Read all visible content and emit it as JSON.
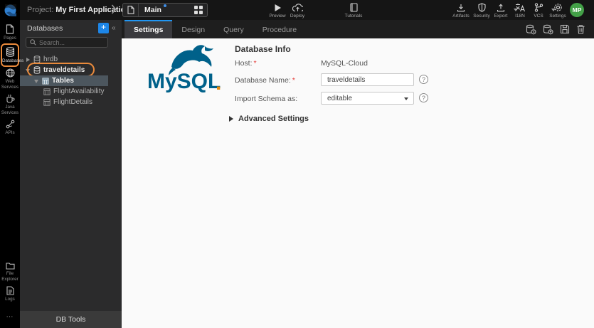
{
  "colors": {
    "accent_blue": "#2196f3",
    "annotation_orange": "#e98a3c",
    "avatar_green": "#43a047",
    "mysql_blue": "#00618a",
    "mysql_orange": "#e8890c"
  },
  "glyphs": {
    "collapse_left": "«",
    "more": "⋯",
    "plus": "+"
  },
  "topbar": {
    "project_label": "Project:",
    "project_name": "My First Application",
    "page_name": "Main",
    "actions": {
      "preview": "Preview",
      "deploy": "Deploy",
      "tutorials": "Tutorials",
      "artifacts": "Artifacts",
      "security": "Security",
      "export": "Export",
      "i18n": "I18N",
      "vcs": "VCS",
      "settings": "Settings"
    },
    "avatar_initials": "MP"
  },
  "rail": {
    "items": [
      {
        "label": "Pages"
      },
      {
        "label": "Databases",
        "active": true
      },
      {
        "label": "Web Services"
      },
      {
        "label": "Java Services"
      },
      {
        "label": "APIs"
      }
    ],
    "bottom_items": [
      {
        "label": "File Explorer"
      },
      {
        "label": "Logs"
      }
    ]
  },
  "panel": {
    "title": "Databases",
    "search_placeholder": "Search...",
    "tree": [
      {
        "label": "hrdb",
        "type": "database",
        "state": "collapsed"
      },
      {
        "label": "traveldetails",
        "type": "database",
        "state": "expanded",
        "annotated": true
      },
      {
        "label": "Tables",
        "type": "table-folder",
        "state": "expanded",
        "selected": true
      },
      {
        "label": "FlightAvailability",
        "type": "table"
      },
      {
        "label": "FlightDetails",
        "type": "table"
      }
    ],
    "footer": "DB Tools"
  },
  "workspace": {
    "tabs": [
      {
        "label": "Settings",
        "active": true
      },
      {
        "label": "Design"
      },
      {
        "label": "Query"
      },
      {
        "label": "Procedure"
      }
    ]
  },
  "form": {
    "logo_text": "MySQL",
    "logo_dot": ".",
    "heading": "Database Info",
    "required_mark": "*",
    "host_label": "Host:",
    "host_value": "MySQL-Cloud",
    "dbname_label": "Database Name:",
    "dbname_value": "traveldetails",
    "schema_label": "Import Schema as:",
    "schema_value": "editable",
    "advanced_label": "Advanced Settings",
    "help_glyph": "?"
  }
}
